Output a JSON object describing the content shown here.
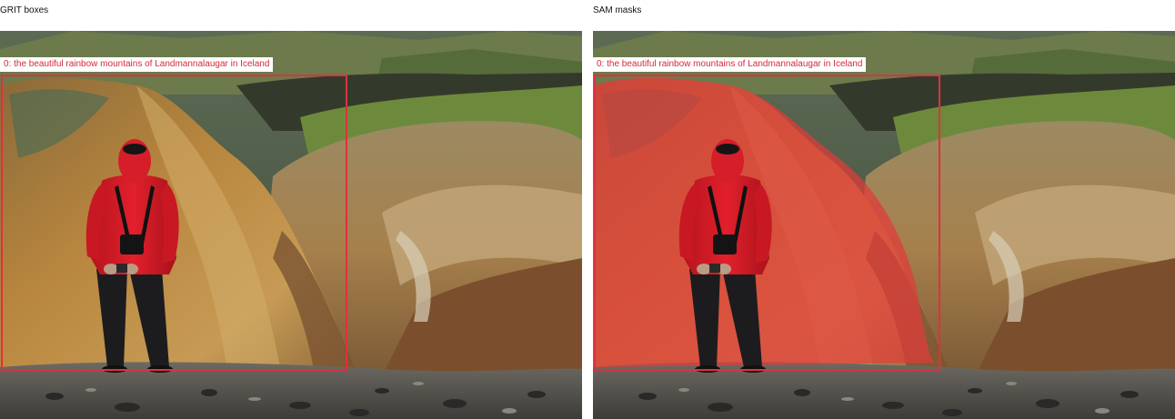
{
  "panels": {
    "left": {
      "title": "GRIT boxes"
    },
    "right": {
      "title": "SAM masks"
    }
  },
  "detection": {
    "label": "0: the beautiful rainbow mountains of Landmannalaugar in Iceland"
  },
  "colors": {
    "box": "#e0303f",
    "label_text": "#d4283c",
    "mask": "#e23a3a"
  }
}
